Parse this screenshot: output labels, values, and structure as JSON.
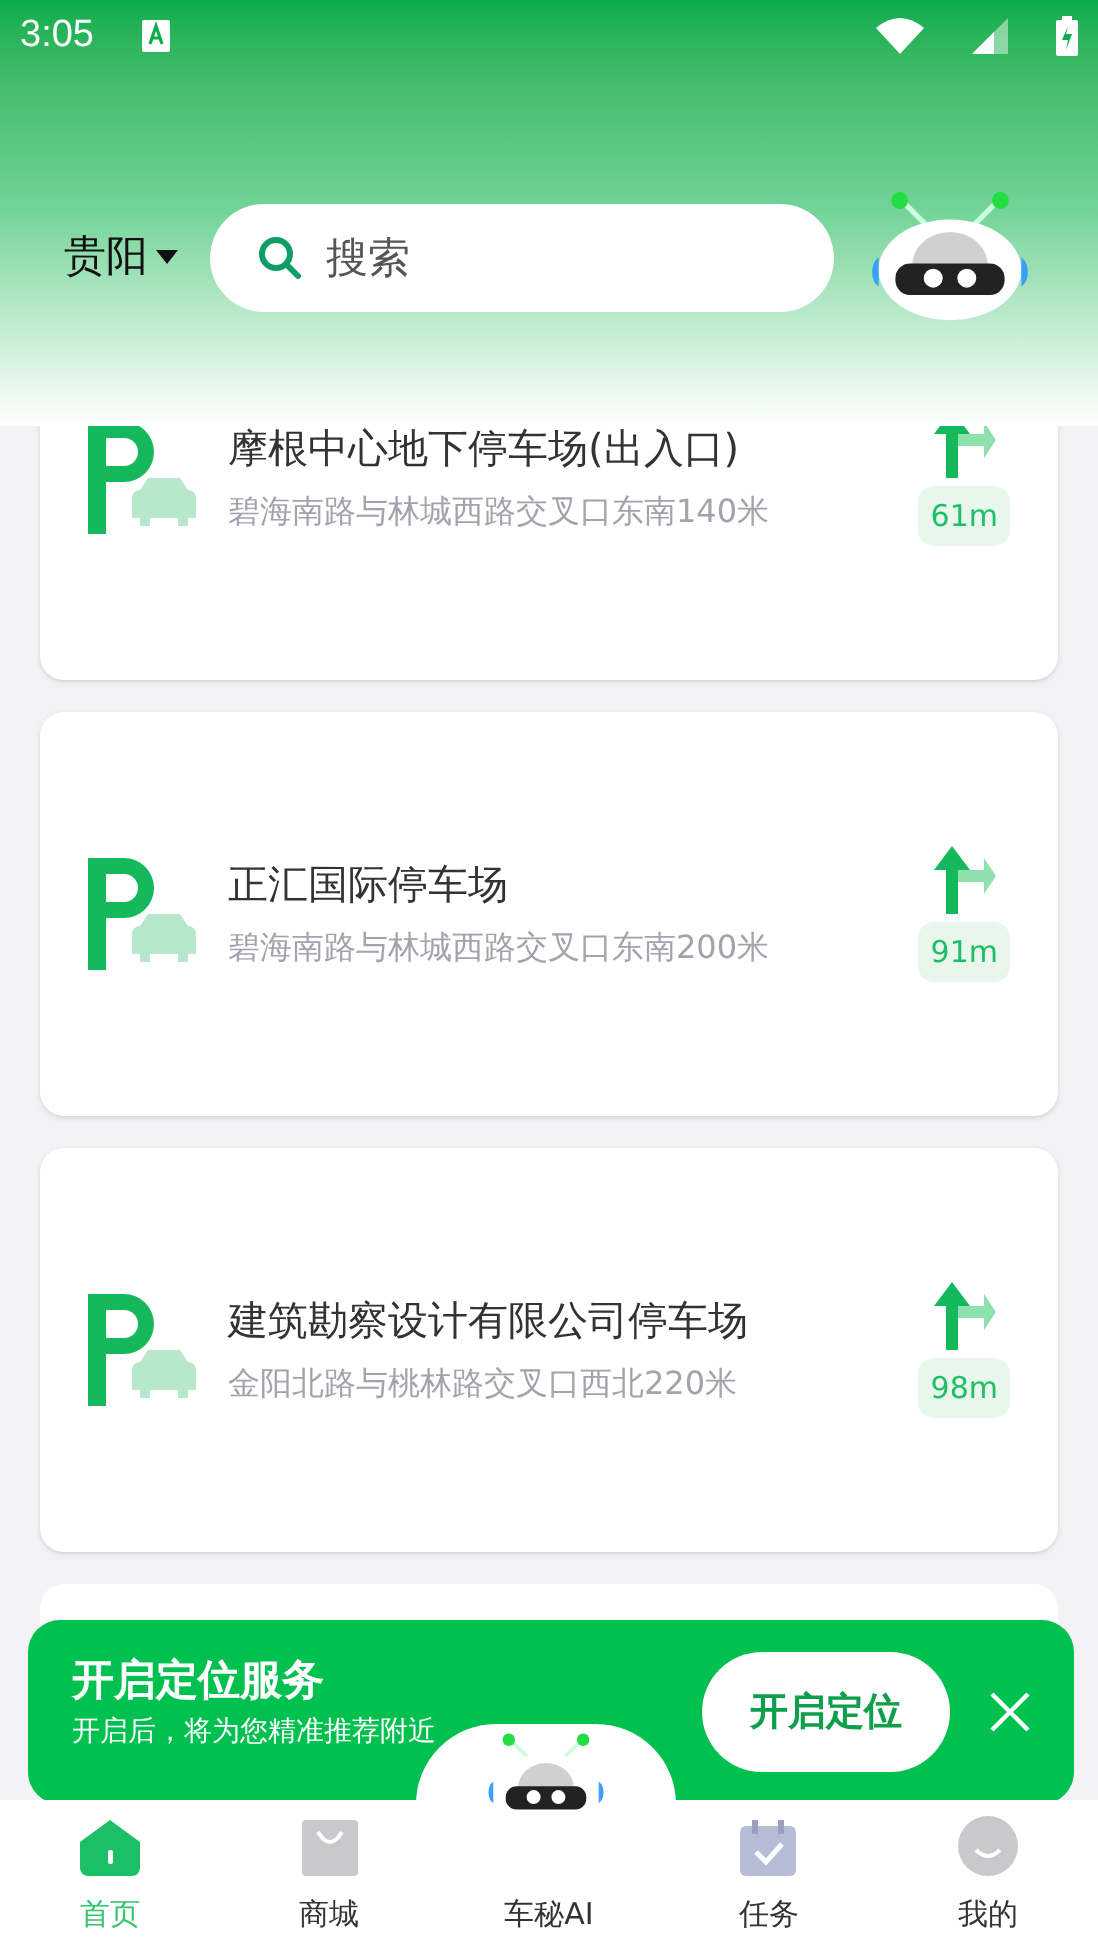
{
  "status_bar": {
    "time": "3:05"
  },
  "header": {
    "city": "贵阳",
    "search": {
      "placeholder": "搜索"
    }
  },
  "parkings": [
    {
      "name": "摩根中心地下停车场(出入口)",
      "address": "碧海南路与林城西路交叉口东南140米",
      "distance": "61m"
    },
    {
      "name": "正汇国际停车场",
      "address": "碧海南路与林城西路交叉口东南200米",
      "distance": "91m"
    },
    {
      "name": "建筑勘察设计有限公司停车场",
      "address": "金阳北路与桃林路交叉口西北220米",
      "distance": "98m"
    }
  ],
  "banner": {
    "title": "开启定位服务",
    "subtitle": "开启后，将为您精准推荐附近",
    "button": "开启定位"
  },
  "nav": [
    {
      "kind": "home",
      "label": "首页",
      "selected": true
    },
    {
      "kind": "shop",
      "label": "商城",
      "selected": false
    },
    {
      "kind": "ai",
      "label": "车秘AI",
      "selected": false
    },
    {
      "kind": "tasks",
      "label": "任务",
      "selected": false
    },
    {
      "kind": "me",
      "label": "我的",
      "selected": false
    }
  ]
}
